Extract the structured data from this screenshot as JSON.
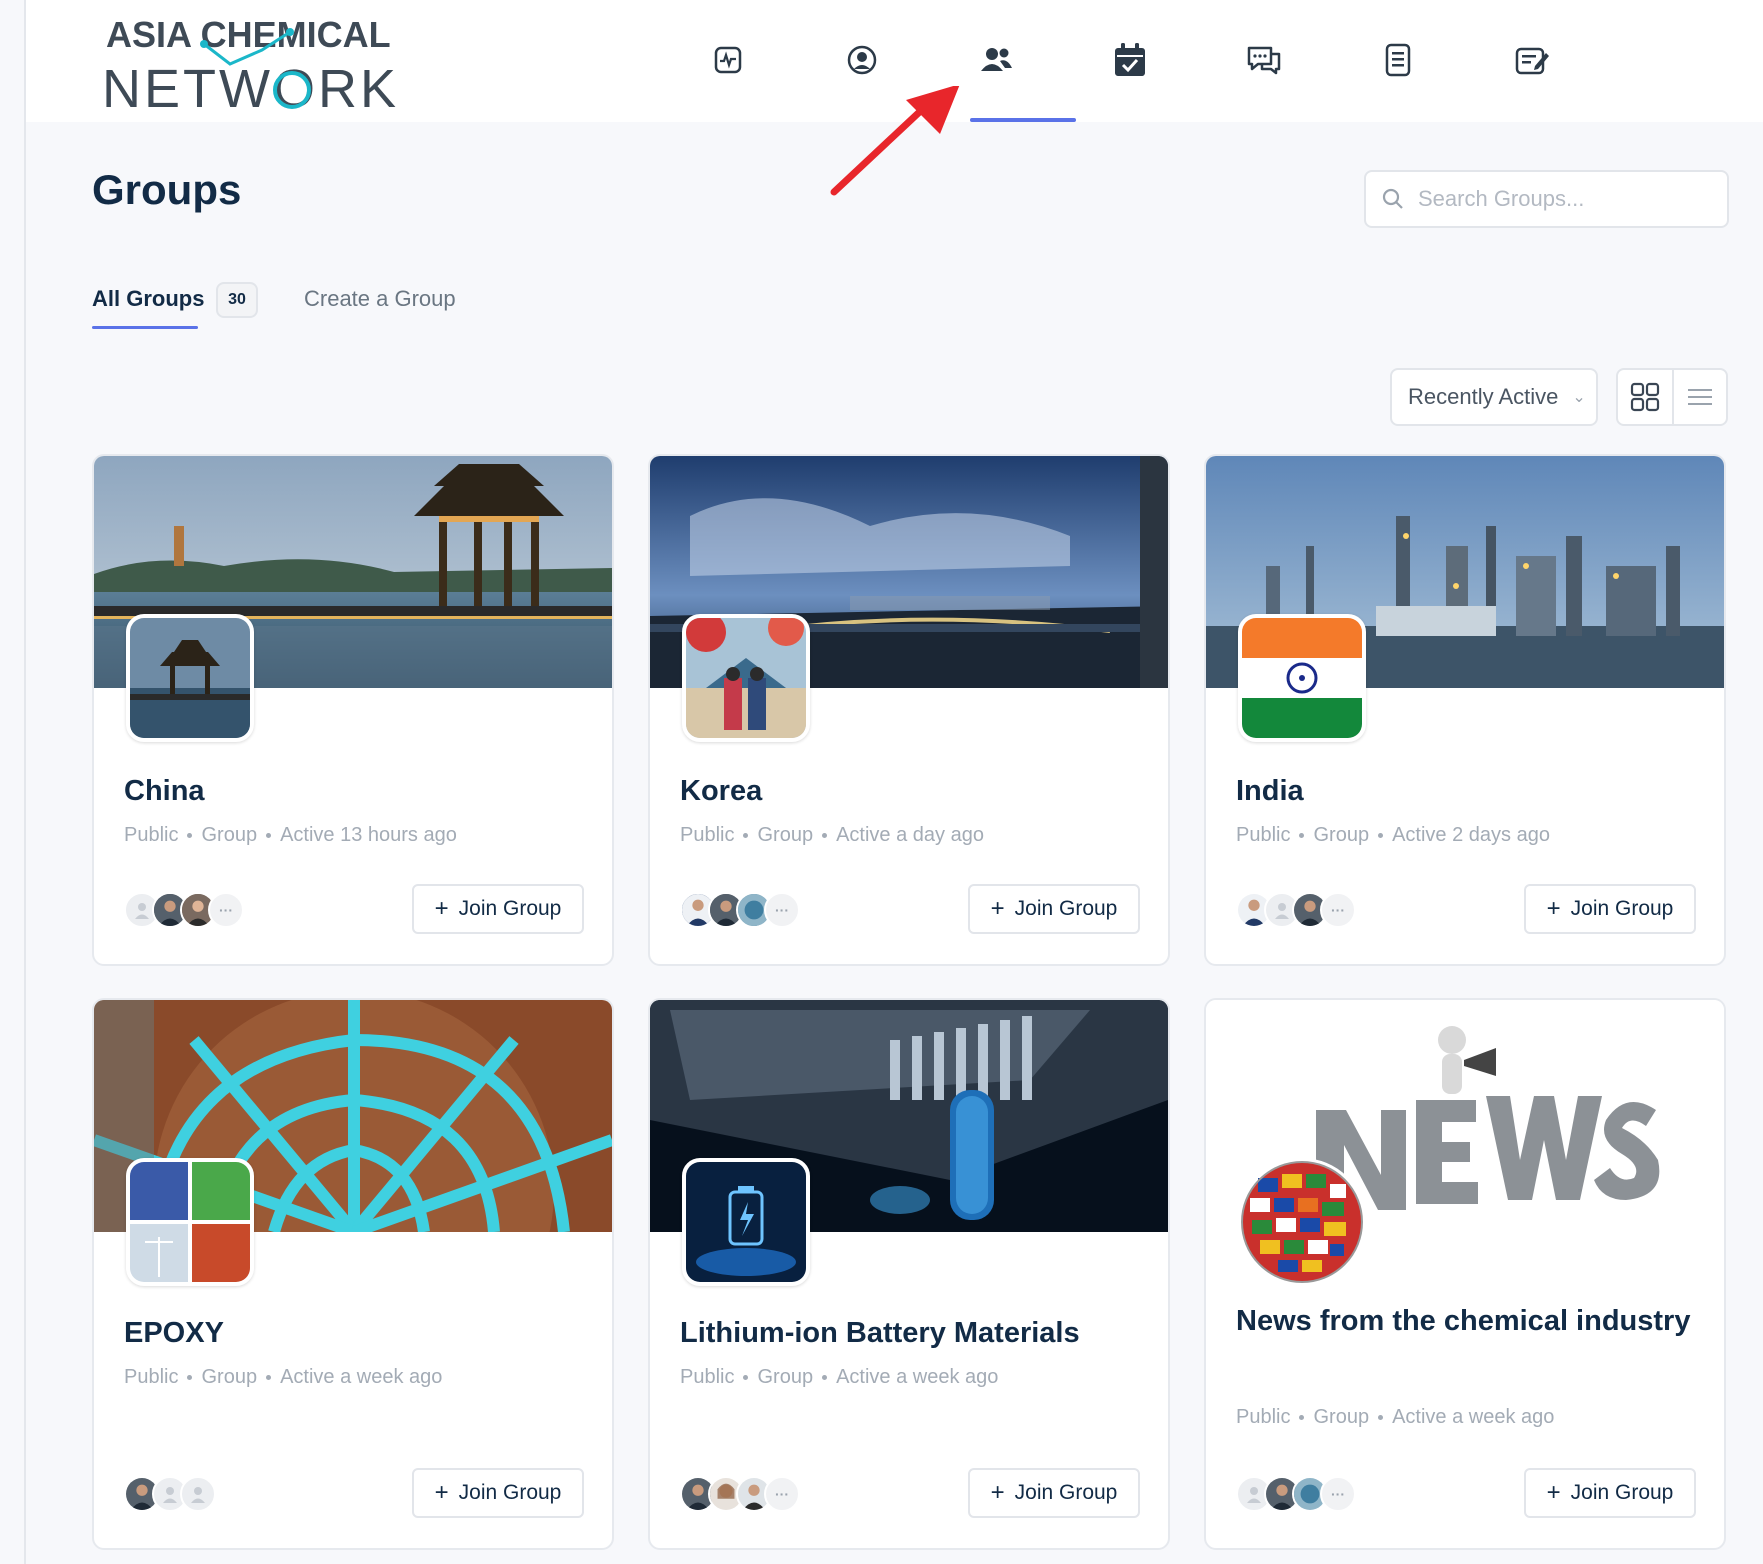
{
  "brand": {
    "line1": "ASIA CHEMICAL",
    "line2": "NETWORK"
  },
  "nav": [
    {
      "name": "activity-icon"
    },
    {
      "name": "profile-icon"
    },
    {
      "name": "groups-icon"
    },
    {
      "name": "events-icon"
    },
    {
      "name": "messages-icon"
    },
    {
      "name": "documents-icon"
    },
    {
      "name": "forums-icon"
    }
  ],
  "page": {
    "title": "Groups"
  },
  "search": {
    "placeholder": "Search Groups..."
  },
  "tabs": {
    "all_label": "All Groups",
    "all_count": "30",
    "create_label": "Create a Group"
  },
  "sort": {
    "selected": "Recently Active"
  },
  "accent": "#5a72e8",
  "join_label": "Join Group",
  "groups": [
    {
      "title": "China",
      "visibility": "Public",
      "type": "Group",
      "activity": "Active 13 hours ago"
    },
    {
      "title": "Korea",
      "visibility": "Public",
      "type": "Group",
      "activity": "Active a day ago"
    },
    {
      "title": "India",
      "visibility": "Public",
      "type": "Group",
      "activity": "Active 2 days ago"
    },
    {
      "title": "EPOXY",
      "visibility": "Public",
      "type": "Group",
      "activity": "Active a week ago"
    },
    {
      "title": "Lithium-ion Battery Materials",
      "visibility": "Public",
      "type": "Group",
      "activity": "Active a week ago"
    },
    {
      "title": "News from the chemical industry",
      "visibility": "Public",
      "type": "Group",
      "activity": "Active a week ago"
    }
  ]
}
